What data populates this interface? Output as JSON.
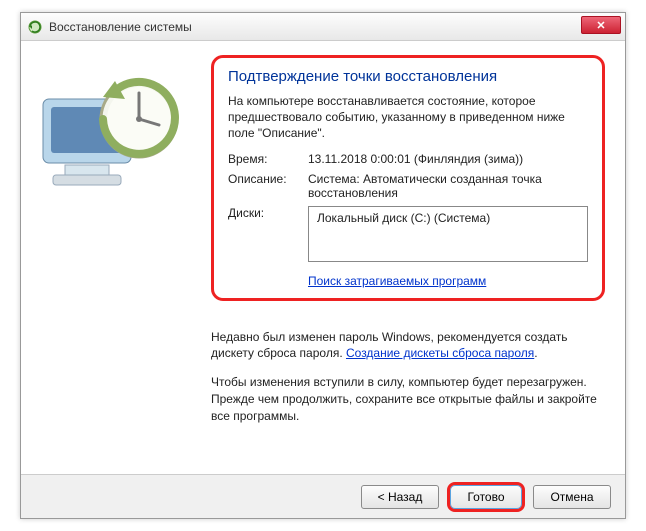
{
  "titlebar": {
    "title": "Восстановление системы"
  },
  "content": {
    "heading": "Подтверждение точки восстановления",
    "intro": "На компьютере восстанавливается состояние, которое предшествовало событию, указанному в приведенном ниже поле \"Описание\".",
    "time_label": "Время:",
    "time_value": "13.11.2018 0:00:01 (Финляндия (зима))",
    "desc_label": "Описание:",
    "desc_value": "Система: Автоматически созданная точка восстановления",
    "disks_label": "Диски:",
    "disks_value": "Локальный диск (C:) (Система)",
    "scan_link": "Поиск затрагиваемых программ",
    "password_note_a": "Недавно был изменен пароль Windows, рекомендуется создать дискету сброса пароля. ",
    "password_link": "Создание дискеты сброса пароля",
    "password_note_b": ".",
    "reboot_note": "Чтобы изменения вступили в силу, компьютер будет перезагружен. Прежде чем продолжить, сохраните все открытые файлы и закройте все программы."
  },
  "footer": {
    "back": "< Назад",
    "finish": "Готово",
    "cancel": "Отмена"
  }
}
